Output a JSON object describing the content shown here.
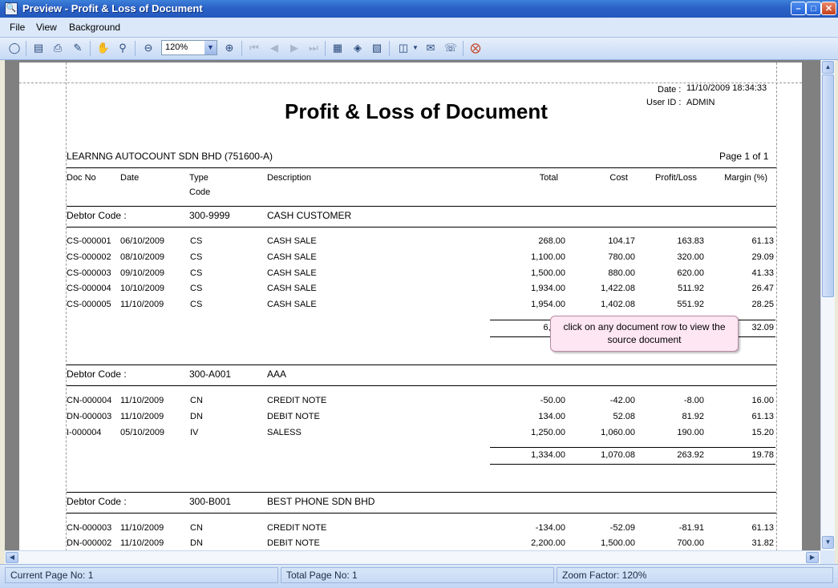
{
  "window": {
    "title": "Preview - Profit & Loss of Document"
  },
  "menu": [
    "File",
    "View",
    "Background"
  ],
  "toolbar": {
    "zoom_value": "120%"
  },
  "report": {
    "date_label": "Date :",
    "date_value": "11/10/2009 18:34:33",
    "user_label": "User ID :",
    "user_value": "ADMIN",
    "title": "Profit & Loss of Document",
    "company": "LEARNNG AUTOCOUNT SDN BHD (751600-A)",
    "page_info": "Page 1 of 1",
    "columns": {
      "doc_no": "Doc No",
      "date": "Date",
      "type": "Type",
      "code": "Code",
      "description": "Description",
      "total": "Total",
      "cost": "Cost",
      "profit_loss": "Profit/Loss",
      "margin": "Margin (%)"
    },
    "groups": [
      {
        "label": "Debtor Code :",
        "code": "300-9999",
        "name": "CASH CUSTOMER",
        "rows": [
          {
            "doc_no": "CS-000001",
            "date": "06/10/2009",
            "type": "CS",
            "description": "CASH SALE",
            "total": "268.00",
            "cost": "104.17",
            "profit": "163.83",
            "margin": "61.13"
          },
          {
            "doc_no": "CS-000002",
            "date": "08/10/2009",
            "type": "CS",
            "description": "CASH SALE",
            "total": "1,100.00",
            "cost": "780.00",
            "profit": "320.00",
            "margin": "29.09"
          },
          {
            "doc_no": "CS-000003",
            "date": "09/10/2009",
            "type": "CS",
            "description": "CASH SALE",
            "total": "1,500.00",
            "cost": "880.00",
            "profit": "620.00",
            "margin": "41.33"
          },
          {
            "doc_no": "CS-000004",
            "date": "10/10/2009",
            "type": "CS",
            "description": "CASH SALE",
            "total": "1,934.00",
            "cost": "1,422.08",
            "profit": "511.92",
            "margin": "26.47"
          },
          {
            "doc_no": "CS-000005",
            "date": "11/10/2009",
            "type": "CS",
            "description": "CASH SALE",
            "total": "1,954.00",
            "cost": "1,402.08",
            "profit": "551.92",
            "margin": "28.25"
          }
        ],
        "subtotal": {
          "total": "6,756",
          "cost": "",
          "profit": "",
          "margin": "32.09"
        }
      },
      {
        "label": "Debtor Code :",
        "code": "300-A001",
        "name": "AAA",
        "rows": [
          {
            "doc_no": "CN-000004",
            "date": "11/10/2009",
            "type": "CN",
            "description": "CREDIT NOTE",
            "total": "-50.00",
            "cost": "-42.00",
            "profit": "-8.00",
            "margin": "16.00"
          },
          {
            "doc_no": "DN-000003",
            "date": "11/10/2009",
            "type": "DN",
            "description": "DEBIT NOTE",
            "total": "134.00",
            "cost": "52.08",
            "profit": "81.92",
            "margin": "61.13"
          },
          {
            "doc_no": "I-000004",
            "date": "05/10/2009",
            "type": "IV",
            "description": "SALESS",
            "total": "1,250.00",
            "cost": "1,060.00",
            "profit": "190.00",
            "margin": "15.20"
          }
        ],
        "subtotal": {
          "total": "1,334.00",
          "cost": "1,070.08",
          "profit": "263.92",
          "margin": "19.78"
        }
      },
      {
        "label": "Debtor Code :",
        "code": "300-B001",
        "name": "BEST PHONE SDN BHD",
        "rows": [
          {
            "doc_no": "CN-000003",
            "date": "11/10/2009",
            "type": "CN",
            "description": "CREDIT NOTE",
            "total": "-134.00",
            "cost": "-52.09",
            "profit": "-81.91",
            "margin": "61.13"
          },
          {
            "doc_no": "DN-000002",
            "date": "11/10/2009",
            "type": "DN",
            "description": "DEBIT NOTE",
            "total": "2,200.00",
            "cost": "1,500.00",
            "profit": "700.00",
            "margin": "31.82"
          }
        ]
      }
    ]
  },
  "tooltip": {
    "text": "click on any document row to view the source document"
  },
  "status": {
    "current_page": "Current Page No: 1",
    "total_page": "Total Page No: 1",
    "zoom_factor": "Zoom Factor: 120%"
  }
}
